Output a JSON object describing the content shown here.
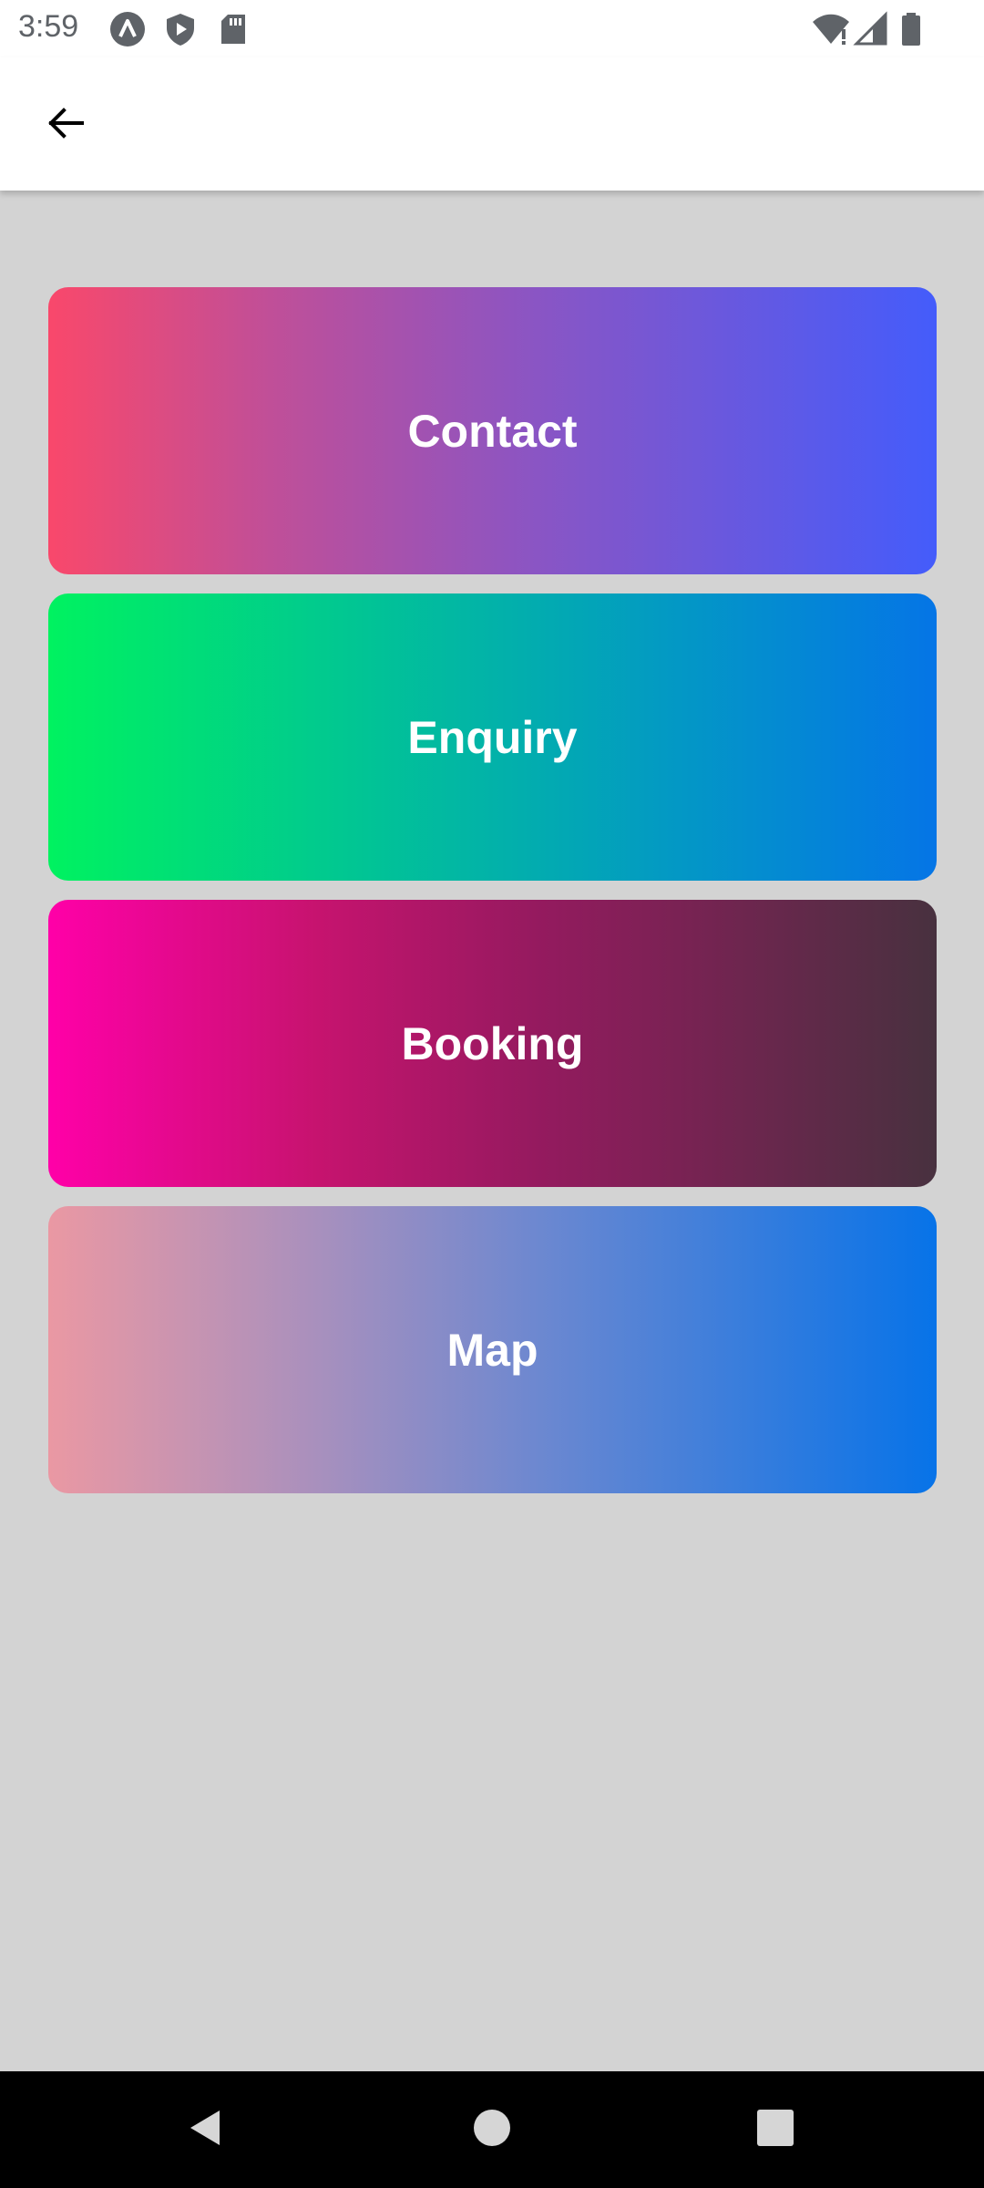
{
  "status_bar": {
    "time": "3:59",
    "icons_left": [
      "ring-a-icon",
      "shield-play-icon",
      "sd-card-icon"
    ],
    "icons_right": [
      "wifi-alert-icon",
      "cell-signal-icon",
      "battery-icon"
    ]
  },
  "app_bar": {
    "back_icon": "arrow-left-icon"
  },
  "menu": {
    "items": [
      {
        "label": "Contact",
        "colors": [
          "#f9486b",
          "#445cfb"
        ]
      },
      {
        "label": "Enquiry",
        "colors": [
          "#00f260",
          "#0575e6"
        ]
      },
      {
        "label": "Booking",
        "colors": [
          "#ff00a8",
          "#48313f"
        ]
      },
      {
        "label": "Map",
        "colors": [
          "#ea98a3",
          "#0773e8"
        ]
      }
    ]
  },
  "nav_bar": {
    "icons": [
      "nav-back-icon",
      "nav-home-icon",
      "nav-recents-icon"
    ]
  },
  "colors": {
    "background": "#d3d3d3",
    "app_bar": "#ffffff",
    "nav_bar": "#000000"
  }
}
